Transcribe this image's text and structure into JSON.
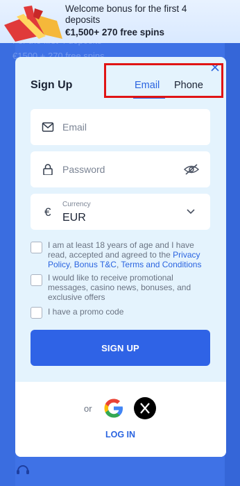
{
  "banner": {
    "line1": "Welcome bonus for the first 4 deposits",
    "line2": "€1,500+ 270 free spins"
  },
  "background": {
    "ghost_line1": "For the first 4 deposits",
    "ghost_line2": "€1500 + 270 free spins"
  },
  "modal": {
    "title": "Sign Up",
    "tabs": [
      {
        "label": "Email",
        "active": true
      },
      {
        "label": "Phone",
        "active": false
      }
    ],
    "email_placeholder": "Email",
    "password_placeholder": "Password",
    "currency_label": "Currency",
    "currency_value": "EUR",
    "currency_symbol": "€",
    "checkbox_age_text": "I am at least 18 years of age and I have read, accepted and agreed to the",
    "checkbox_age_links": [
      "Privacy Policy",
      "Bonus T&C",
      "Terms and Conditions"
    ],
    "checkbox_promo_text": "I would like to receive promotional messages, casino news, bonuses, and exclusive offers",
    "checkbox_code_text": "I have a promo code",
    "signup_button": "SIGN UP",
    "or_text": "or",
    "login_link": "LOG IN"
  },
  "colors": {
    "accent": "#2f63e6",
    "background": "#3f72e6",
    "modal_bg": "#e4f3fd",
    "highlight": "#e01414"
  },
  "icons": [
    "gift-icon",
    "close-icon",
    "mail-icon",
    "lock-icon",
    "eye-off-icon",
    "chevron-down-icon",
    "google-icon",
    "x-icon",
    "chat-icon"
  ]
}
